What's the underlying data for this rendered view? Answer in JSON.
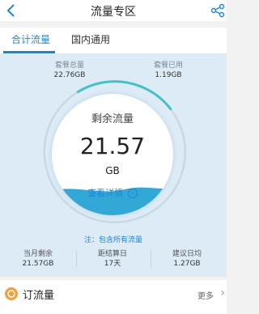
{
  "header": {
    "title": "流量专区"
  },
  "tabs": [
    {
      "label": "合计流量"
    },
    {
      "label": "国内通用"
    }
  ],
  "summary": {
    "total_label": "套餐总量",
    "total_value": "22.76GB",
    "used_label": "套餐已用",
    "used_value": "1.19GB"
  },
  "circle": {
    "label": "剩余流量",
    "value": "21.57",
    "unit": "GB",
    "detail_label": "查看详情",
    "detail_chevron": "›"
  },
  "note": "注：包含所有流量",
  "stats": [
    {
      "label": "当月剩余",
      "value": "21.57GB"
    },
    {
      "label": "距结算日",
      "value": "17天"
    },
    {
      "label": "建议日均",
      "value": "1.27GB"
    }
  ],
  "order": {
    "label": "订流量",
    "more": "更多",
    "chevron": "›"
  },
  "colors": {
    "accent": "#1b88d6",
    "panel": "#dcebf6",
    "ring": "#46c0c5",
    "water": "#33a7d6",
    "order_icon": "#f2a03d"
  },
  "icons": {
    "back": "chevron-left-icon",
    "share": "share-icon",
    "order": "order-icon",
    "detail": "chevron-right-circle-icon"
  }
}
